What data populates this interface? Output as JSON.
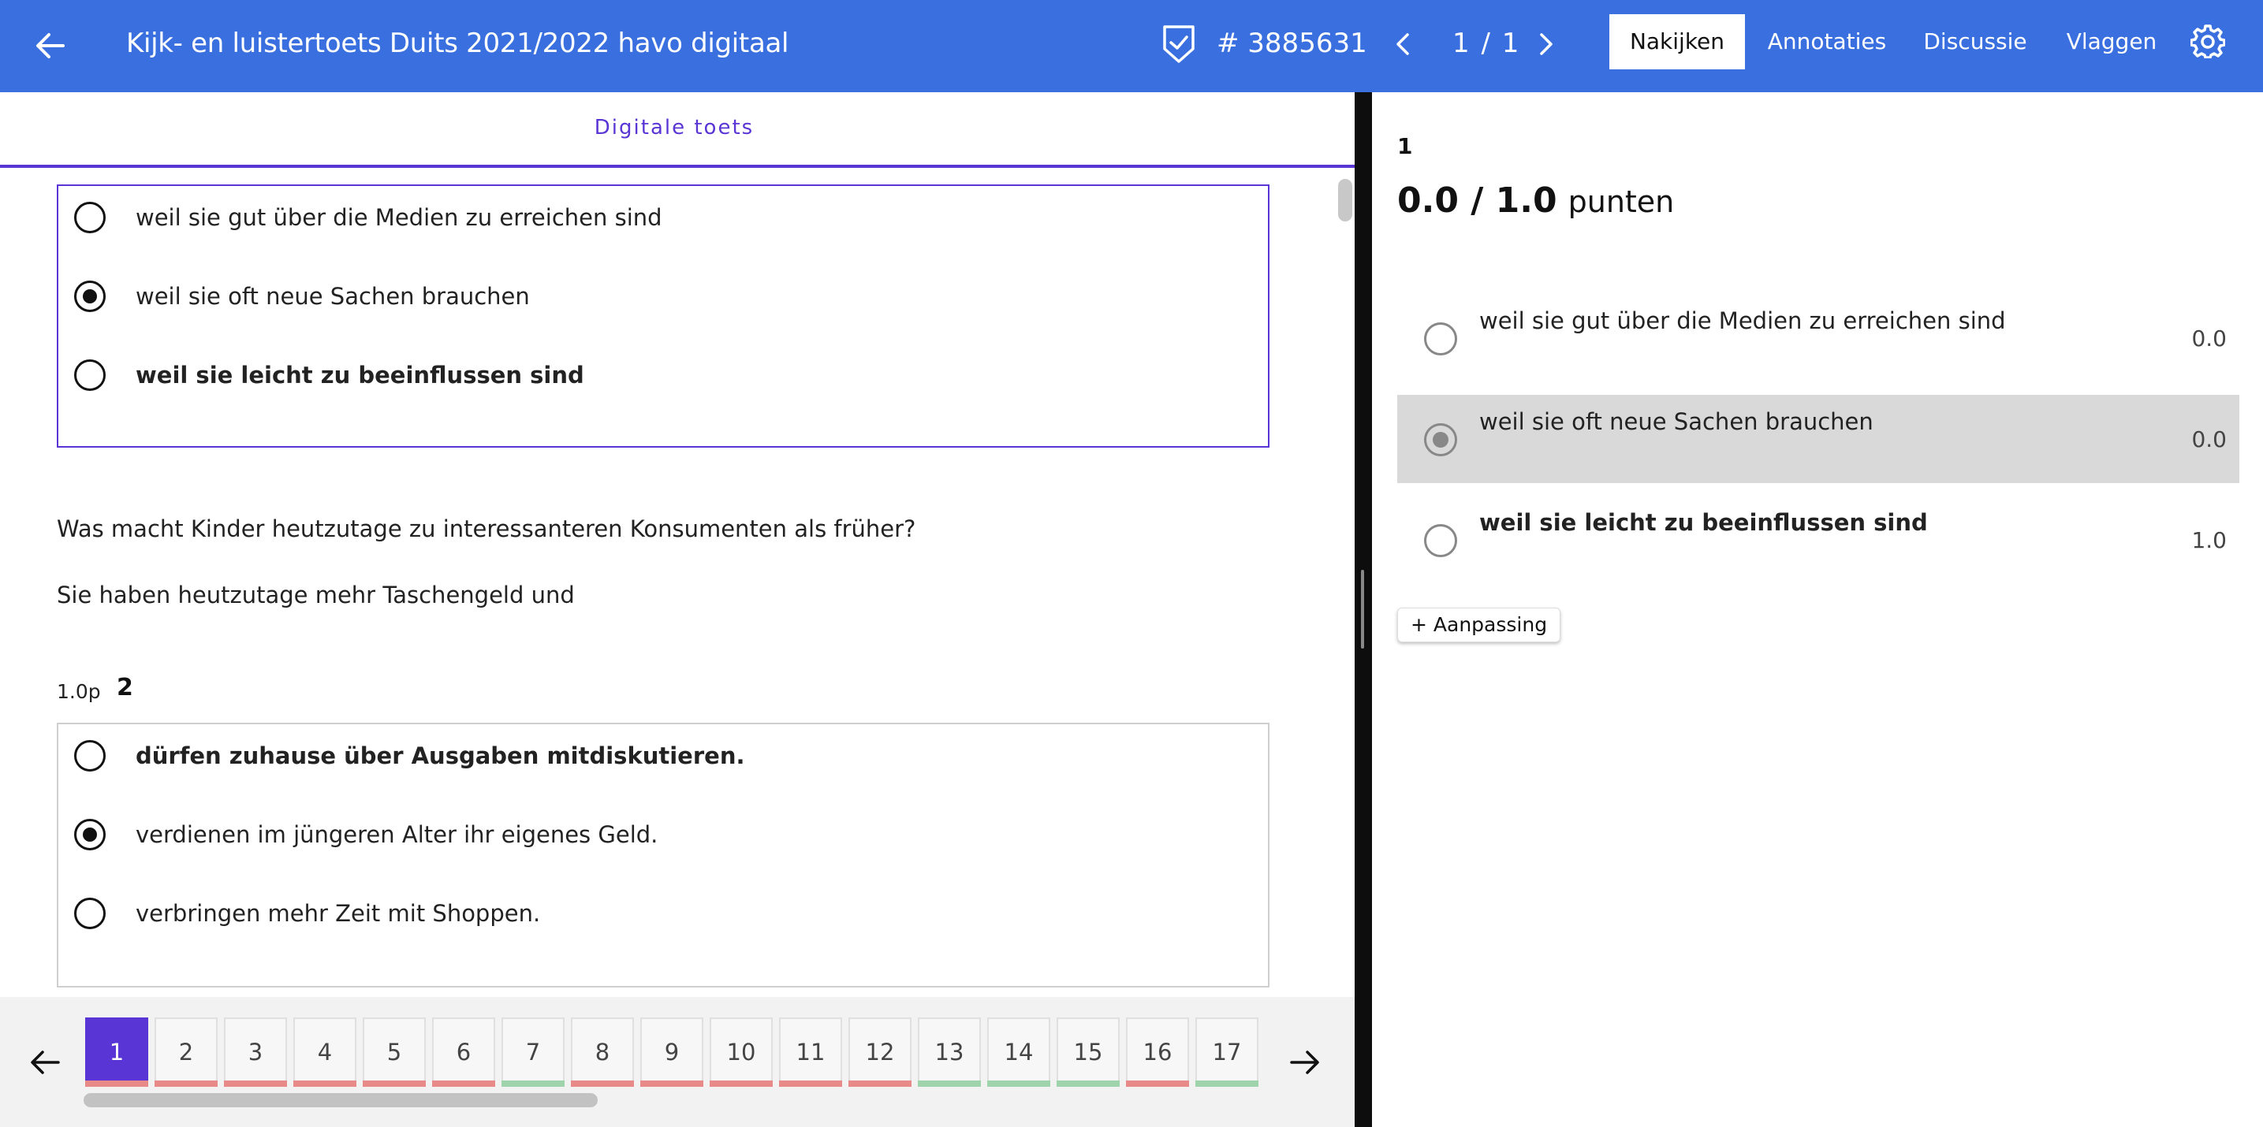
{
  "header": {
    "title": "Kijk- en luistertoets Duits 2021/2022 havo digitaal",
    "id_label": "# 3885631",
    "pager": "1 / 1",
    "tabs": [
      {
        "label": "Nakijken",
        "active": true
      },
      {
        "label": "Annotaties",
        "active": false
      },
      {
        "label": "Discussie",
        "active": false
      },
      {
        "label": "Vlaggen",
        "active": false
      }
    ],
    "colors": {
      "bar": "#3a6fe0",
      "accent": "#5a35d6"
    }
  },
  "left": {
    "subtab": "Digitale toets",
    "question1": {
      "options": [
        {
          "text": "weil sie gut über die Medien zu erreichen sind",
          "selected": false,
          "bold": false
        },
        {
          "text": "weil sie oft neue Sachen brauchen",
          "selected": true,
          "bold": false
        },
        {
          "text": "weil sie leicht zu beeinflussen sind",
          "selected": false,
          "bold": true
        }
      ]
    },
    "prompt": "Was macht Kinder heutzutage zu interessanteren Konsumenten als früher?",
    "stem": "Sie haben heutzutage mehr Taschengeld und",
    "question2": {
      "points": "1.0p",
      "number": "2",
      "options": [
        {
          "text": "dürfen zuhause über Ausgaben mitdiskutieren.",
          "selected": false,
          "bold": true
        },
        {
          "text": "verdienen im jüngeren Alter ihr eigenes Geld.",
          "selected": true,
          "bold": false
        },
        {
          "text": "verbringen mehr Zeit mit Shoppen.",
          "selected": false,
          "bold": false
        }
      ]
    }
  },
  "navigator": {
    "questions": [
      {
        "label": "1",
        "status": "red",
        "active": true
      },
      {
        "label": "2",
        "status": "red"
      },
      {
        "label": "3",
        "status": "red"
      },
      {
        "label": "4",
        "status": "red"
      },
      {
        "label": "5",
        "status": "red"
      },
      {
        "label": "6",
        "status": "red"
      },
      {
        "label": "7",
        "status": "green"
      },
      {
        "label": "8",
        "status": "red"
      },
      {
        "label": "9",
        "status": "red"
      },
      {
        "label": "10",
        "status": "red"
      },
      {
        "label": "11",
        "status": "red"
      },
      {
        "label": "12",
        "status": "red"
      },
      {
        "label": "13",
        "status": "green"
      },
      {
        "label": "14",
        "status": "green"
      },
      {
        "label": "15",
        "status": "green"
      },
      {
        "label": "16",
        "status": "red"
      },
      {
        "label": "17",
        "status": "green"
      }
    ],
    "status_colors": {
      "red": "#e88a88",
      "green": "#9fd3ac"
    }
  },
  "right": {
    "number": "1",
    "score": "0.0 / 1.0",
    "score_unit": "punten",
    "options": [
      {
        "text": "weil sie gut über die Medien zu erreichen sind",
        "points": "0.0",
        "selected": false,
        "bold": false
      },
      {
        "text": "weil sie oft neue Sachen brauchen",
        "points": "0.0",
        "selected": true,
        "bold": false
      },
      {
        "text": "weil sie leicht zu beeinflussen sind",
        "points": "1.0",
        "selected": false,
        "bold": true
      }
    ],
    "adjust_label": "+ Aanpassing"
  }
}
